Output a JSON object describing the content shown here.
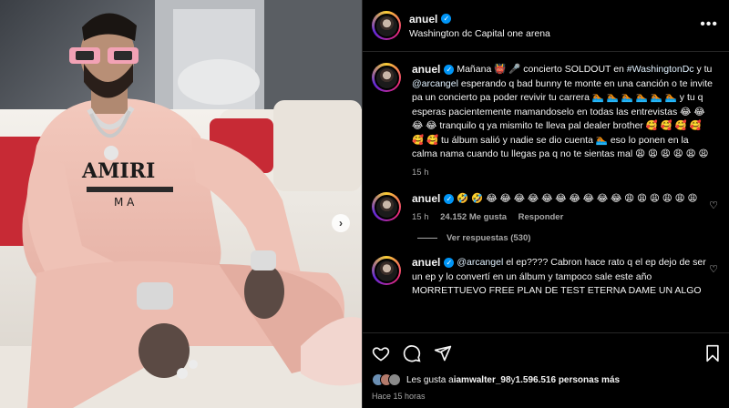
{
  "post": {
    "username": "anuel",
    "location": "Washington dc Capital one arena",
    "more_label": "•••",
    "next_label": "›"
  },
  "comments": [
    {
      "username": "anuel",
      "text_a": "Mañana 👹 🎤 concierto SOLDOUT en ",
      "hashtag": "#WashingtonDc",
      "text_b": " y tu ",
      "mention": "@arcangel",
      "text_c": " esperando q bad bunny te monte en una canción o te invite pa un concierto pa poder revivir tu carrera 🏊🏽 🏊🏽 🏊🏽 🏊🏽 🏊🏽 🏊🏽 y tu q esperas pacientemente mamandoselo en todas las entrevistas 😂 😂 😂 😂 tranquilo q ya mismito te lleva pal dealer brother 🥰 🥰 🥰 🥰 🥰 🥰 tu álbum salió y nadie se dio cuenta 🏊🏽 eso lo ponen en la calma nama cuando tu llegas pa q no te sientas mal 😩 😩 😩 😩 😩 😩",
      "time": "15 h"
    },
    {
      "username": "anuel",
      "text": "🤣 🤣 😂 😂 😂 😂 😂 😂 😂 😂 😂 😂 😩 😩 😩 😩 😩 😩",
      "time": "15 h",
      "likes": "24.152 Me gusta",
      "reply_label": "Responder",
      "view_replies": "Ver respuestas (530)"
    },
    {
      "username": "anuel",
      "mention": "@arcangel",
      "text": " el ep???? Cabron hace rato q el ep dejo de ser un ep y lo convertí en un álbum y tampoco sale este año MORRETTUEVO FREE PLAN DE TEST ETERNA DAME UN ALGO"
    }
  ],
  "actions": {
    "icons": [
      "heart-icon",
      "comment-icon",
      "share-icon",
      "bookmark-icon"
    ]
  },
  "likes_summary": {
    "prefix": "Les gusta a ",
    "user": "iamwalter_98",
    "middle": " y ",
    "count": "1.596.516 personas más"
  },
  "posted": "Hace 15 horas"
}
